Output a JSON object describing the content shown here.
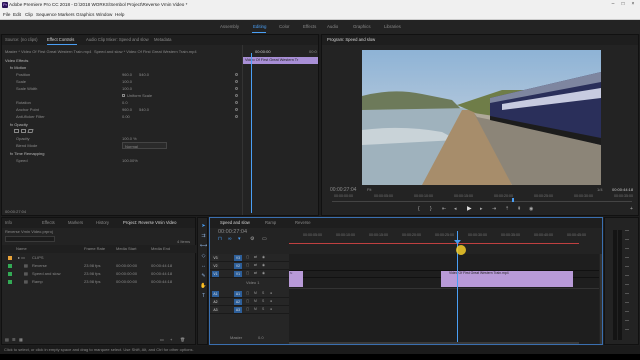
{
  "window": {
    "title": "Adobe Premiere Pro CC 2018 - D:\\2018 WORKS\\Sembol Project\\Reverse Vmin Video *"
  },
  "menu": [
    "File",
    "Edit",
    "Clip",
    "Sequence",
    "Markers",
    "Graphics",
    "Window",
    "Help"
  ],
  "workspaces": [
    "Assembly",
    "Editing",
    "Color",
    "Effects",
    "Audio",
    "Graphics",
    "Libraries"
  ],
  "source_panel": {
    "tabs": [
      "Source: (no clips)",
      "Effect Controls",
      "Audio Clip Mixer: Speed and slow",
      "Metadata"
    ],
    "breadcrumb_master": "Master * Video Of First Great Western Train.mp4",
    "breadcrumb_seq": "Speed and slow * Video Of First Great Western Train.mp4",
    "time_label": "00:00:00",
    "time_label2": "00:0",
    "clip_bar": "Video Of First Great Western Tr",
    "section_video": "Video Effects",
    "fx_motion": "fx  Motion",
    "rows": [
      {
        "label": "Position",
        "v1": "960.0",
        "v2": "540.0"
      },
      {
        "label": "Scale",
        "v1": "100.0",
        "v2": ""
      },
      {
        "label": "Scale Width",
        "v1": "100.0",
        "v2": ""
      },
      {
        "label": "",
        "v1": "Uniform Scale",
        "v2": ""
      },
      {
        "label": "Rotation",
        "v1": "0.0",
        "v2": ""
      },
      {
        "label": "Anchor Point",
        "v1": "960.0",
        "v2": "540.0"
      },
      {
        "label": "Anti-flicker Filter",
        "v1": "0.00",
        "v2": ""
      }
    ],
    "fx_opacity": "fx  Opacity",
    "opacity_label": "Opacity",
    "opacity_value": "100.0 %",
    "blend_label": "Blend Mode",
    "blend_value": "Normal",
    "time_remap": "fx  Time Remapping",
    "speed_label": "Speed",
    "speed_value": "100.00%",
    "bottom_time": "00:00:27:04"
  },
  "program_panel": {
    "title": "Program: Speed and slow",
    "timecode": "00:00:27:04",
    "fit": "Fit",
    "ratio": "1/4",
    "duration": "00:00:44:18",
    "ruler": [
      "00:00:00:00",
      "00:00:05:00",
      "00:00:10:00",
      "00:00:15:00",
      "00:00:20:00",
      "00:00:25:00",
      "00:00:30:00",
      "00:00:35:00"
    ]
  },
  "project_panel": {
    "tabs": [
      "Info",
      "Effects",
      "Markers",
      "History",
      "Project: Reverse Vmin Video"
    ],
    "project_file": "Reverse Vmin Video.prproj",
    "items_count": "4 Items",
    "columns": [
      "Name",
      "Frame Rate",
      "Media Start",
      "Media End"
    ],
    "items": [
      {
        "name": "CLIPS",
        "fr": "",
        "start": "",
        "end": "",
        "color": "#e8a33a",
        "kind": "bin"
      },
      {
        "name": "Reverse",
        "fr": "23.98 fps",
        "start": "00:00:00:00",
        "end": "00:00:44:18",
        "color": "#33aa55",
        "kind": "seq"
      },
      {
        "name": "Speed and slow",
        "fr": "23.98 fps",
        "start": "00:00:00:00",
        "end": "00:00:44:18",
        "color": "#33aa55",
        "kind": "seq"
      },
      {
        "name": "Ramp",
        "fr": "23.98 fps",
        "start": "00:00:00:00",
        "end": "00:00:44:18",
        "color": "#33aa55",
        "kind": "seq"
      }
    ]
  },
  "timeline": {
    "tabs": [
      "Speed and slow",
      "Ramp",
      "Reverse"
    ],
    "timecode": "00:00:27:04",
    "ruler": [
      "00:00:05:00",
      "00:00:10:00",
      "00:00:15:00",
      "00:00:20:00",
      "00:00:25:00",
      "00:00:30:00",
      "00:00:35:00",
      "00:00:40:00",
      "00:00:45:00"
    ],
    "video_tracks": [
      "V3",
      "V2",
      "V1"
    ],
    "audio_tracks": [
      "A1",
      "A2",
      "A3"
    ],
    "v1_name": "Video 1",
    "master_label": "Master",
    "master_value": "0.0",
    "clip_label": "Video Of First Great Western Train.mp4",
    "fx_badge": "fx"
  },
  "status": {
    "text": "Click to select, or click in empty space and drag to marquee select. Use Shift, Alt, and Ctrl for other options."
  }
}
